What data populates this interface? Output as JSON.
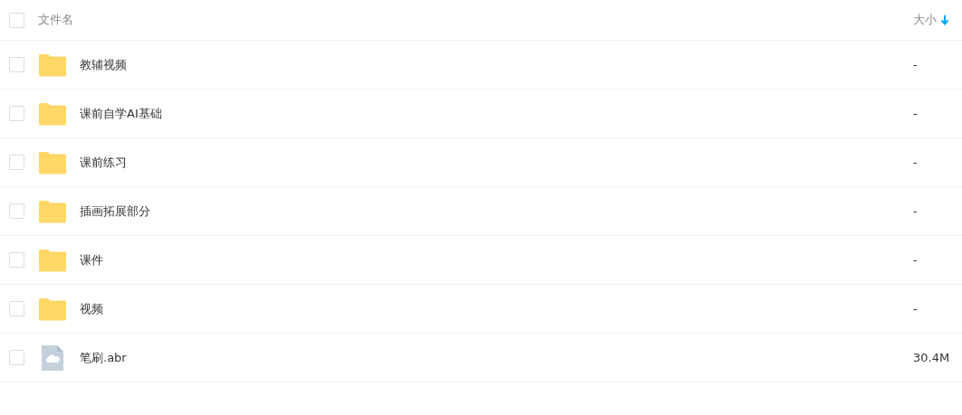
{
  "header": {
    "checked": false,
    "name_label": "文件名",
    "size_label": "大小"
  },
  "rows": [
    {
      "kind": "folder",
      "name": "教辅视频",
      "size": "-",
      "checked": false
    },
    {
      "kind": "folder",
      "name": "课前自学AI基础",
      "size": "-",
      "checked": false
    },
    {
      "kind": "folder",
      "name": "课前练习",
      "size": "-",
      "checked": false
    },
    {
      "kind": "folder",
      "name": "插画拓展部分",
      "size": "-",
      "checked": false
    },
    {
      "kind": "folder",
      "name": "课件",
      "size": "-",
      "checked": false
    },
    {
      "kind": "folder",
      "name": "视频",
      "size": "-",
      "checked": false
    },
    {
      "kind": "file",
      "name": "笔刷.abr",
      "size": "30.4M",
      "checked": false
    }
  ]
}
